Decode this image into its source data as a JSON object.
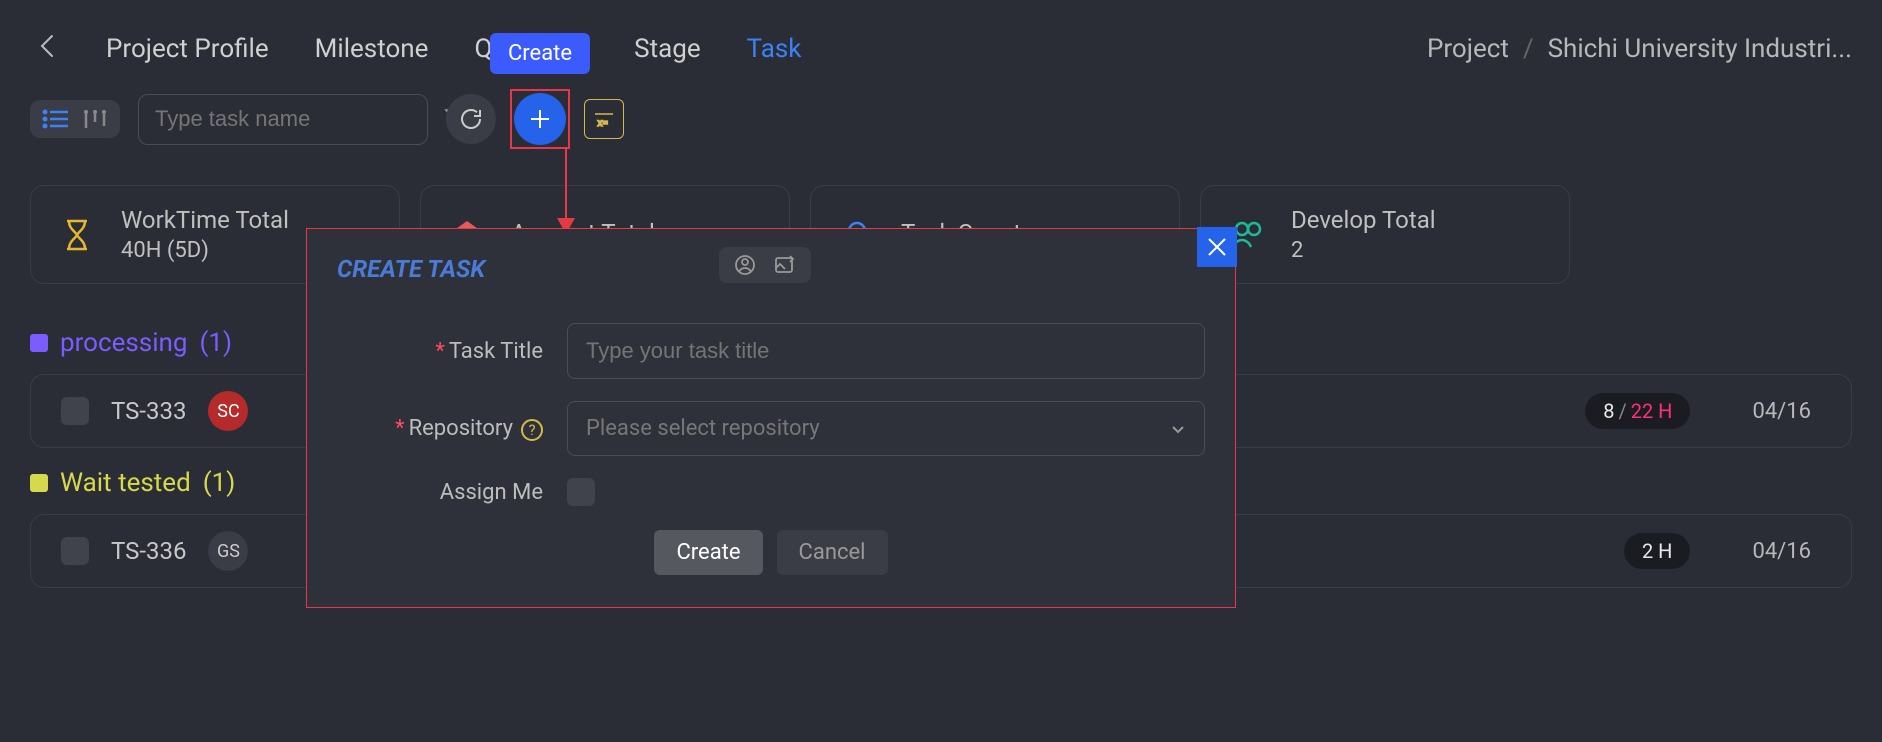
{
  "nav": {
    "tabs": [
      "Project Profile",
      "Milestone",
      "Quotation",
      "Stage",
      "Task"
    ],
    "active": "Task"
  },
  "breadcrumb": {
    "root": "Project",
    "current": "Shichi University Industri..."
  },
  "toolbar": {
    "search_placeholder": "Type task name",
    "create_tooltip": "Create"
  },
  "stats": [
    {
      "icon": "hourglass",
      "label": "WorkTime Total",
      "value": "40H (5D)"
    },
    {
      "icon": "amount",
      "label": "Amount Total",
      "value": ""
    },
    {
      "icon": "count",
      "label": "Task Count",
      "value": ""
    },
    {
      "icon": "dev",
      "label": "Develop Total",
      "value": "2"
    }
  ],
  "groups": {
    "processing": {
      "label": "processing",
      "count": "(1)"
    },
    "wait": {
      "label": "Wait tested",
      "count": "(1)"
    }
  },
  "tasks": {
    "processing": [
      {
        "id": "TS-333",
        "avatar": "av1",
        "avatar_text": "SC",
        "hours_a": "8",
        "hours_b": "22 H",
        "date": "04/16"
      }
    ],
    "wait": [
      {
        "id": "TS-336",
        "avatar": "av2",
        "avatar_text": "GS",
        "hours_single": "2 H",
        "date": "04/16"
      }
    ]
  },
  "modal": {
    "title": "CREATE TASK",
    "labels": {
      "task_title": "Task Title",
      "repository": "Repository",
      "assign_me": "Assign Me"
    },
    "placeholders": {
      "task_title": "Type your task title",
      "repository": "Please select repository"
    },
    "buttons": {
      "create": "Create",
      "cancel": "Cancel"
    }
  }
}
